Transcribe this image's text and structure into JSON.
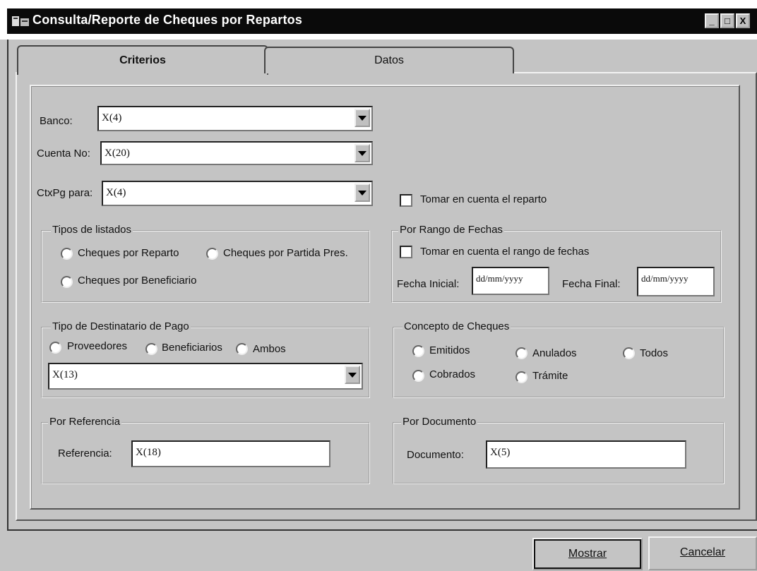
{
  "window": {
    "title": "Consulta/Reporte  de  Cheques por Repartos",
    "controls": {
      "minimize": "_",
      "maximize": "□",
      "close": "X"
    }
  },
  "tabs": [
    {
      "label": "Criterios",
      "active": true
    },
    {
      "label": "Datos",
      "active": false
    }
  ],
  "fields": {
    "banco": {
      "label": "Banco:",
      "value": "X(4)"
    },
    "cuenta": {
      "label": "Cuenta No:",
      "value": "X(20)"
    },
    "ctxpg": {
      "label": "CtxPg para:",
      "value": "X(4)"
    }
  },
  "tomar_reparto": {
    "label": "Tomar en cuenta el reparto",
    "checked": false
  },
  "tipos_listados": {
    "title": "Tipos de listados",
    "options": [
      "Cheques por Reparto",
      "Cheques por Partida Pres.",
      "Cheques por Beneficiario"
    ]
  },
  "rango_fechas": {
    "title": "Por Rango  de  Fechas",
    "check_label": "Tomar en cuenta el rango de fechas",
    "inicial_label": "Fecha Inicial:",
    "inicial_value": "dd/mm/yyyy",
    "final_label": "Fecha  Final:",
    "final_value": "dd/mm/yyyy"
  },
  "destinatario": {
    "title": "Tipo de Destinatario de Pago",
    "options": [
      "Proveedores",
      "Beneficiarios",
      "Ambos"
    ],
    "value": "X(13)"
  },
  "concepto": {
    "title": "Concepto de Cheques",
    "options": [
      "Emitidos",
      "Anulados",
      "Todos",
      "Cobrados",
      "Trámite"
    ]
  },
  "referencia": {
    "title": "Por Referencia",
    "label": "Referencia:",
    "value": "X(18)"
  },
  "documento": {
    "title": "Por Documento",
    "label": "Documento:",
    "value": "X(5)"
  },
  "buttons": {
    "mostrar": "Mostrar",
    "cancelar": "Cancelar"
  }
}
